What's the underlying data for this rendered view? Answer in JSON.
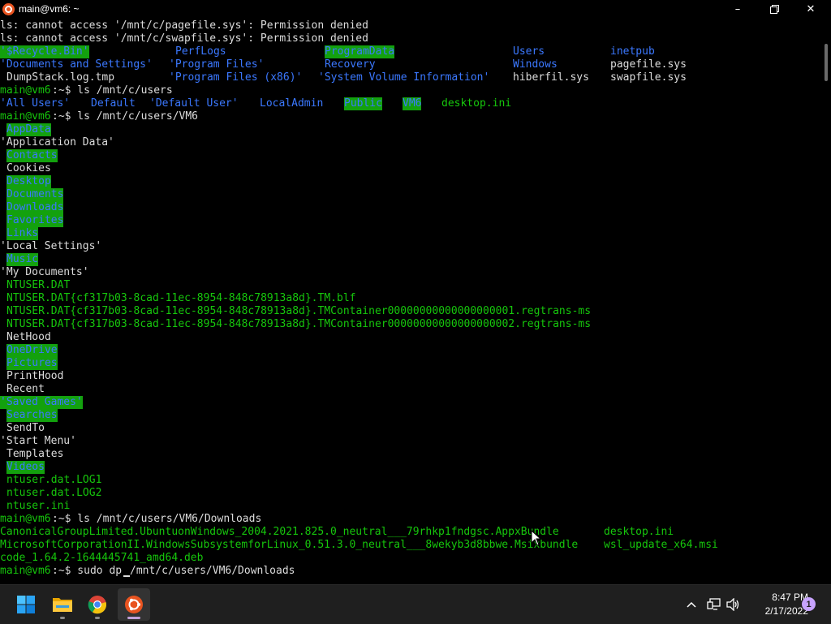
{
  "window": {
    "title": "main@vm6: ~",
    "icon": "ubuntu-icon",
    "controls": {
      "minimize": "minimize-icon",
      "maximize": "maximize-icon",
      "close": "close-icon"
    }
  },
  "terminal": {
    "colors": {
      "background": "#000000",
      "text": "#dcdcdc",
      "directory": "#3b78ff",
      "executable": "#16c60c",
      "highlight_bg": "#13a10e"
    },
    "lines": [
      {
        "segs": [
          {
            "col": 0,
            "text": "ls: cannot access '/mnt/c/pagefile.sys': Permission denied",
            "style": "norm"
          }
        ]
      },
      {
        "segs": [
          {
            "col": 0,
            "text": "ls: cannot access '/mnt/c/swapfile.sys': Permission denied",
            "style": "norm"
          }
        ]
      },
      {
        "segs": [
          {
            "col": 0,
            "text": "'$Recycle.Bin'",
            "style": "hl"
          },
          {
            "col": 27,
            "text": "PerfLogs",
            "style": "blue"
          },
          {
            "col": 50,
            "text": "ProgramData",
            "style": "hl"
          },
          {
            "col": 79,
            "text": "Users",
            "style": "blue"
          },
          {
            "col": 94,
            "text": "inetpub",
            "style": "blue"
          }
        ]
      },
      {
        "segs": [
          {
            "col": 0,
            "text": "'Documents and Settings'",
            "style": "blue"
          },
          {
            "col": 26,
            "text": "'Program Files'",
            "style": "blue"
          },
          {
            "col": 50,
            "text": "Recovery",
            "style": "blue"
          },
          {
            "col": 79,
            "text": "Windows",
            "style": "blue"
          },
          {
            "col": 94,
            "text": "pagefile.sys",
            "style": "norm"
          }
        ]
      },
      {
        "segs": [
          {
            "col": 1,
            "text": "DumpStack.log.tmp",
            "style": "norm"
          },
          {
            "col": 26,
            "text": "'Program Files (x86)'",
            "style": "blue"
          },
          {
            "col": 49,
            "text": "'System Volume Information'",
            "style": "blue"
          },
          {
            "col": 79,
            "text": "hiberfil.sys",
            "style": "norm"
          },
          {
            "col": 94,
            "text": "swapfile.sys",
            "style": "norm"
          }
        ]
      },
      {
        "segs": [
          {
            "col": 0,
            "text": "main@vm6",
            "style": "prompt"
          },
          {
            "col": 8,
            "text": ":~$ ls /mnt/c/users",
            "style": "plain"
          }
        ]
      },
      {
        "segs": [
          {
            "col": 0,
            "text": "'All Users'",
            "style": "blue"
          },
          {
            "col": 14,
            "text": "Default",
            "style": "blue"
          },
          {
            "col": 23,
            "text": "'Default User'",
            "style": "blue"
          },
          {
            "col": 40,
            "text": "LocalAdmin",
            "style": "blue"
          },
          {
            "col": 53,
            "text": "Public",
            "style": "hl"
          },
          {
            "col": 62,
            "text": "VM6",
            "style": "hl"
          },
          {
            "col": 68,
            "text": "desktop.ini",
            "style": "green"
          }
        ]
      },
      {
        "segs": [
          {
            "col": 0,
            "text": "main@vm6",
            "style": "prompt"
          },
          {
            "col": 8,
            "text": ":~$ ls /mnt/c/users/VM6",
            "style": "plain"
          }
        ]
      },
      {
        "segs": [
          {
            "col": 1,
            "text": "AppData",
            "style": "hl"
          }
        ]
      },
      {
        "segs": [
          {
            "col": 0,
            "text": "'Application Data'",
            "style": "norm"
          }
        ]
      },
      {
        "segs": [
          {
            "col": 1,
            "text": "Contacts",
            "style": "hl"
          }
        ]
      },
      {
        "segs": [
          {
            "col": 1,
            "text": "Cookies",
            "style": "norm"
          }
        ]
      },
      {
        "segs": [
          {
            "col": 1,
            "text": "Desktop",
            "style": "hl"
          }
        ]
      },
      {
        "segs": [
          {
            "col": 1,
            "text": "Documents",
            "style": "hl"
          }
        ]
      },
      {
        "segs": [
          {
            "col": 1,
            "text": "Downloads",
            "style": "hl"
          }
        ]
      },
      {
        "segs": [
          {
            "col": 1,
            "text": "Favorites",
            "style": "hl"
          }
        ]
      },
      {
        "segs": [
          {
            "col": 1,
            "text": "Links",
            "style": "hl"
          }
        ]
      },
      {
        "segs": [
          {
            "col": 0,
            "text": "'Local Settings'",
            "style": "norm"
          }
        ]
      },
      {
        "segs": [
          {
            "col": 1,
            "text": "Music",
            "style": "hl"
          }
        ]
      },
      {
        "segs": [
          {
            "col": 0,
            "text": "'My Documents'",
            "style": "norm"
          }
        ]
      },
      {
        "segs": [
          {
            "col": 1,
            "text": "NTUSER.DAT",
            "style": "green"
          }
        ]
      },
      {
        "segs": [
          {
            "col": 1,
            "text": "NTUSER.DAT{cf317b03-8cad-11ec-8954-848c78913a8d}.TM.blf",
            "style": "green"
          }
        ]
      },
      {
        "segs": [
          {
            "col": 1,
            "text": "NTUSER.DAT{cf317b03-8cad-11ec-8954-848c78913a8d}.TMContainer00000000000000000001.regtrans-ms",
            "style": "green"
          }
        ]
      },
      {
        "segs": [
          {
            "col": 1,
            "text": "NTUSER.DAT{cf317b03-8cad-11ec-8954-848c78913a8d}.TMContainer00000000000000000002.regtrans-ms",
            "style": "green"
          }
        ]
      },
      {
        "segs": [
          {
            "col": 1,
            "text": "NetHood",
            "style": "norm"
          }
        ]
      },
      {
        "segs": [
          {
            "col": 1,
            "text": "OneDrive",
            "style": "hl"
          }
        ]
      },
      {
        "segs": [
          {
            "col": 1,
            "text": "Pictures",
            "style": "hl"
          }
        ]
      },
      {
        "segs": [
          {
            "col": 1,
            "text": "PrintHood",
            "style": "norm"
          }
        ]
      },
      {
        "segs": [
          {
            "col": 1,
            "text": "Recent",
            "style": "norm"
          }
        ]
      },
      {
        "segs": [
          {
            "col": 0,
            "text": "'Saved Games'",
            "style": "hl"
          }
        ]
      },
      {
        "segs": [
          {
            "col": 1,
            "text": "Searches",
            "style": "hl"
          }
        ]
      },
      {
        "segs": [
          {
            "col": 1,
            "text": "SendTo",
            "style": "norm"
          }
        ]
      },
      {
        "segs": [
          {
            "col": 0,
            "text": "'Start Menu'",
            "style": "norm"
          }
        ]
      },
      {
        "segs": [
          {
            "col": 1,
            "text": "Templates",
            "style": "norm"
          }
        ]
      },
      {
        "segs": [
          {
            "col": 1,
            "text": "Videos",
            "style": "hl"
          }
        ]
      },
      {
        "segs": [
          {
            "col": 1,
            "text": "ntuser.dat.LOG1",
            "style": "green"
          }
        ]
      },
      {
        "segs": [
          {
            "col": 1,
            "text": "ntuser.dat.LOG2",
            "style": "green"
          }
        ]
      },
      {
        "segs": [
          {
            "col": 1,
            "text": "ntuser.ini",
            "style": "green"
          }
        ]
      },
      {
        "segs": [
          {
            "col": 0,
            "text": "main@vm6",
            "style": "prompt"
          },
          {
            "col": 8,
            "text": ":~$ ls /mnt/c/users/VM6/Downloads",
            "style": "plain"
          }
        ]
      },
      {
        "segs": [
          {
            "col": 0,
            "text": "CanonicalGroupLimited.UbuntuonWindows_2004.2021.825.0_neutral___79rhkp1fndgsc.AppxBundle",
            "style": "green"
          },
          {
            "col": 93,
            "text": "desktop.ini",
            "style": "green"
          }
        ]
      },
      {
        "segs": [
          {
            "col": 0,
            "text": "MicrosoftCorporationII.WindowsSubsystemforLinux_0.51.3.0_neutral___8wekyb3d8bbwe.Msixbundle",
            "style": "green"
          },
          {
            "col": 93,
            "text": "wsl_update_x64.msi",
            "style": "green"
          }
        ]
      },
      {
        "segs": [
          {
            "col": 0,
            "text": "code_1.64.2-1644445741_amd64.deb",
            "style": "green"
          }
        ]
      },
      {
        "segs": [
          {
            "col": 0,
            "text": "main@vm6",
            "style": "prompt"
          },
          {
            "col": 8,
            "text": ":~$ sudo dp",
            "style": "plain"
          },
          {
            "col": 20,
            "text": "/mnt/c/users/VM6/Downloads",
            "style": "plain"
          }
        ],
        "cursor_col": 19
      }
    ]
  },
  "taskbar": {
    "apps": [
      {
        "name": "start-button",
        "icon": "windows-logo-icon",
        "active": false
      },
      {
        "name": "file-explorer-button",
        "icon": "folder-icon",
        "active": false
      },
      {
        "name": "chrome-button",
        "icon": "chrome-icon",
        "active": false
      },
      {
        "name": "ubuntu-terminal-button",
        "icon": "ubuntu-icon",
        "active": true
      }
    ],
    "tray": {
      "chevron_icon": "chevron-up-icon",
      "network_icon": "network-icon",
      "volume_icon": "volume-icon",
      "time": "8:47 PM",
      "date": "2/17/2022",
      "notification_count": "1"
    }
  }
}
